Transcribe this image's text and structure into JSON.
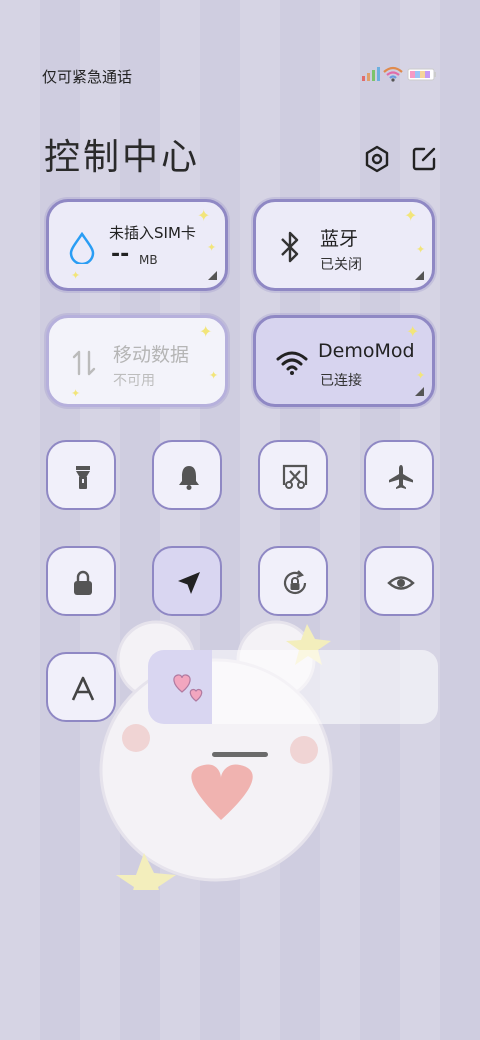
{
  "status_bar": {
    "carrier_text": "仅可紧急通话"
  },
  "header": {
    "title": "控制中心"
  },
  "tiles": {
    "sim": {
      "title": "未插入SIM卡",
      "value": "--",
      "unit": "MB"
    },
    "bluetooth": {
      "title": "蓝牙",
      "status": "已关闭"
    },
    "mobile_data": {
      "title": "移动数据",
      "status": "不可用"
    },
    "wifi": {
      "title": "DemoMod",
      "status": "已连接"
    }
  },
  "brightness": {
    "level": 0.22
  },
  "icons": {
    "settings": "settings-icon",
    "edit": "edit-icon",
    "flashlight": "flashlight-icon",
    "bell": "bell-icon",
    "screenshot": "screenshot-icon",
    "airplane": "airplane-icon",
    "lock": "lock-icon",
    "location": "location-icon",
    "rotation": "rotation-lock-icon",
    "eye": "eye-icon",
    "font": "font-icon",
    "hearts": "hearts-icon"
  },
  "colors": {
    "accent": "#8f88c4",
    "tile_bg": "#ecebf8",
    "active_bg": "#d9d6f1"
  }
}
